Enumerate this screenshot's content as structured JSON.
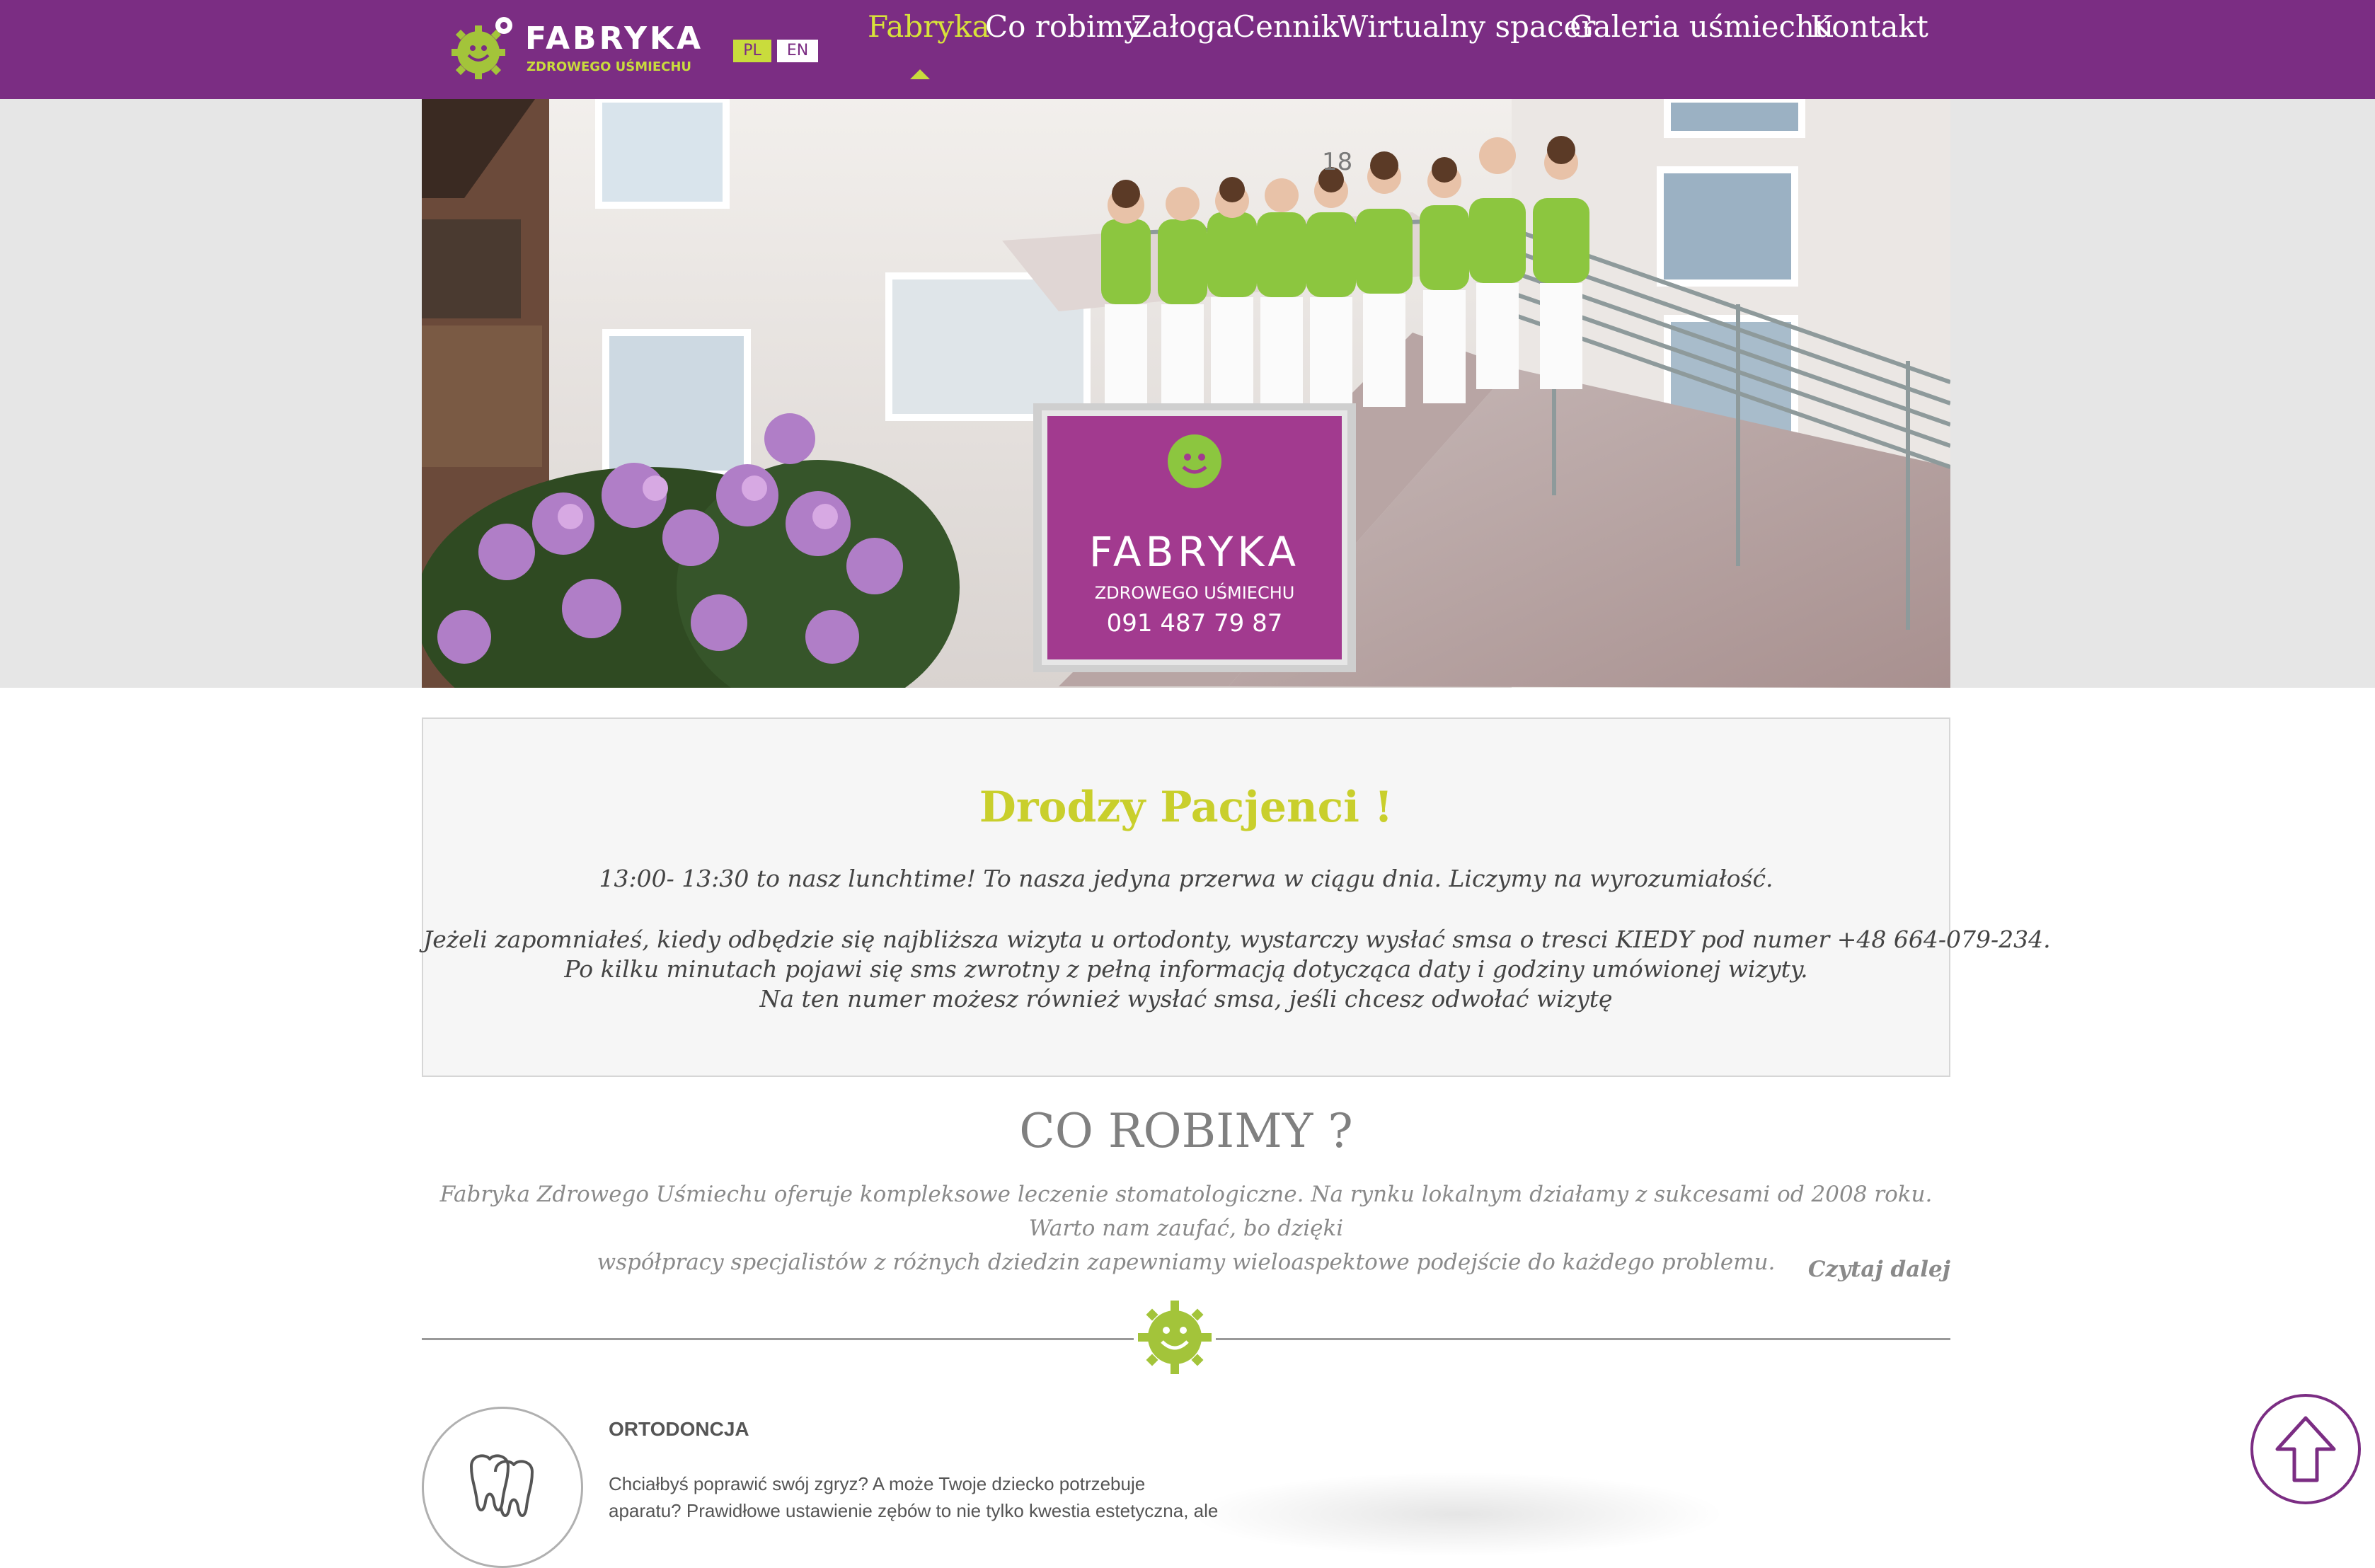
{
  "brand": {
    "name": "FABRYKA",
    "tagline": "ZDROWEGO UŚMIECHU",
    "primary_color": "#7b2d83",
    "accent_color": "#c9dc3c"
  },
  "languages": {
    "pl": "PL",
    "en": "EN",
    "selected": "PL"
  },
  "nav": {
    "items": [
      "Fabryka",
      "Co robimy",
      "Załoga",
      "Cennik",
      "Wirtualny spacer",
      "Galeria uśmiechu",
      "Kontakt"
    ],
    "active": "Fabryka"
  },
  "hero": {
    "building_number": "18",
    "sign_title": "FABRYKA",
    "sign_subtitle": "ZDROWEGO UŚMIECHU",
    "sign_phone": "091 487 79 87"
  },
  "notice": {
    "title": "Drodzy Pacjenci !",
    "line1": "13:00- 13:30 to nasz lunchtime! To nasza jedyna przerwa w ciągu dnia. Liczymy na wyrozumiałość.",
    "line2": "Jeżeli zapomniałeś, kiedy odbędzie się najbliższa wizyta u ortodonty, wystarczy wysłać smsa o tresci KIEDY pod numer +48 664-079-234.",
    "line3": "Po kilku minutach pojawi się sms zwrotny z pełną informacją dotycząca daty i godziny umówionej wizyty.",
    "line4": "Na ten numer możesz również wysłać smsa, jeśli chcesz odwołać wizytę"
  },
  "about": {
    "title": "CO ROBIMY ?",
    "text_line1": "Fabryka Zdrowego Uśmiechu oferuje kompleksowe leczenie stomatologiczne. Na rynku lokalnym działamy z sukcesami od 2008 roku. Warto nam zaufać, bo dzięki",
    "text_line2": "współpracy specjalistów z różnych dziedzin zapewniamy wieloaspektowe podejście do każdego problemu.",
    "read_more": "Czytaj dalej"
  },
  "services": [
    {
      "title": "ORTODONCJA",
      "text_line1": "Chciałbyś poprawić swój zgryz? A może Twoje dziecko potrzebuje",
      "text_line2": "aparatu? Prawidłowe ustawienie zębów to nie tylko kwestia estetyczna, ale",
      "icon": "tooth-icon"
    }
  ],
  "scroll_top": {
    "icon": "arrow-up-icon"
  }
}
